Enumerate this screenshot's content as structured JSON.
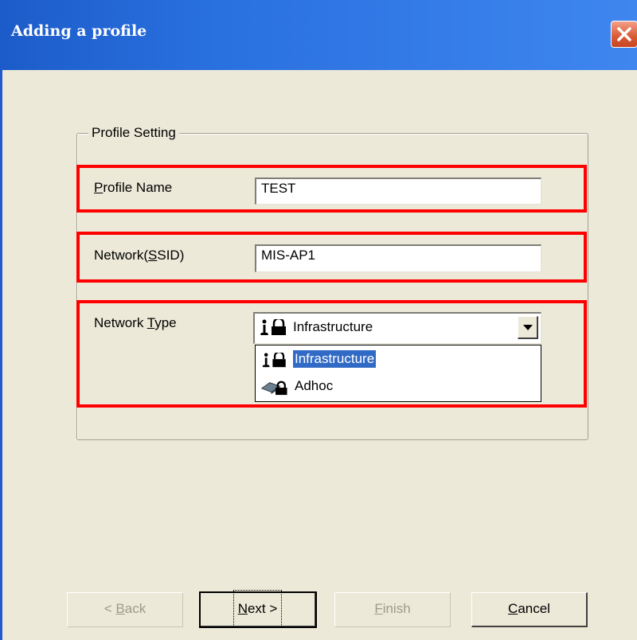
{
  "window": {
    "title": "Adding a profile"
  },
  "group": {
    "legend": "Profile Setting"
  },
  "fields": {
    "profile_name": {
      "label_mnemonic": "P",
      "label_rest": "rofile Name",
      "value": "TEST"
    },
    "ssid": {
      "label_pre": "Network(",
      "label_mnemonic": "S",
      "label_post": "SID)",
      "value": "MIS-AP1"
    },
    "network_type": {
      "label_pre": "Network ",
      "label_mnemonic": "T",
      "label_post": "ype",
      "selected": "Infrastructure",
      "options": [
        {
          "label": "Infrastructure",
          "icon": "infrastructure-icon"
        },
        {
          "label": "Adhoc",
          "icon": "adhoc-icon"
        }
      ]
    }
  },
  "buttons": {
    "back": {
      "pre": "< ",
      "mnemonic": "B",
      "post": "ack"
    },
    "next": {
      "mnemonic": "N",
      "post": "ext >"
    },
    "finish": {
      "mnemonic": "F",
      "post": "inish"
    },
    "cancel": {
      "mnemonic": "C",
      "post": "ancel"
    }
  },
  "colors": {
    "titlebar": "#2a71e0",
    "highlight_box": "#ff0000",
    "selection": "#316ac5"
  }
}
